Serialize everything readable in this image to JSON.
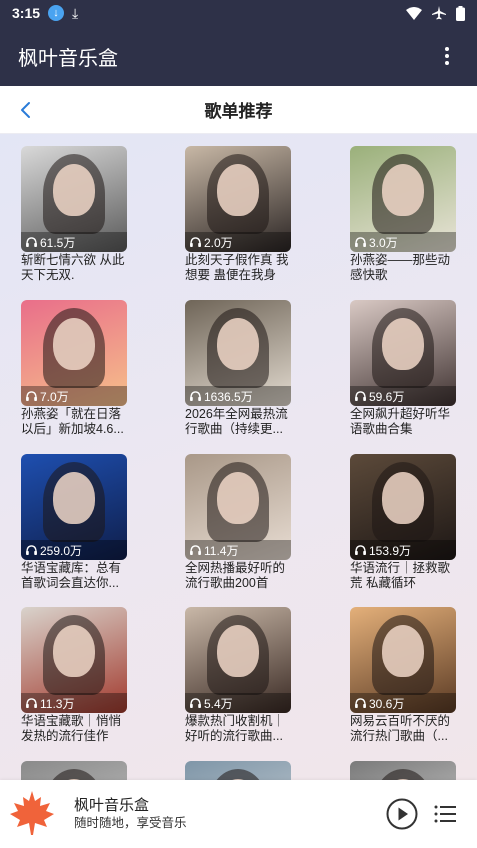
{
  "status_bar": {
    "time": "3:15",
    "icons": [
      "download-badge-icon",
      "download-icon",
      "wifi-icon",
      "airplane-icon",
      "battery-icon"
    ]
  },
  "app_bar": {
    "title": "枫叶音乐盒",
    "menu_icon": "more-vertical-icon"
  },
  "page_header": {
    "title": "歌单推荐",
    "back_icon": "chevron-left-icon"
  },
  "playlists": [
    {
      "count": "61.5万",
      "title": "斩断七情六欲 从此天下无双.",
      "colors": [
        "#d9d9d9",
        "#5a5a5a"
      ]
    },
    {
      "count": "2.0万",
      "title": "此刻天子假作真 我想要 蛊便在我身",
      "colors": [
        "#c8b8a6",
        "#2b2524"
      ]
    },
    {
      "count": "3.0万",
      "title": "孙燕姿——那些动感快歌",
      "colors": [
        "#9ab07a",
        "#e9e4d8"
      ]
    },
    {
      "count": "7.0万",
      "title": "孙燕姿「就在日落以后」新加坡4.6...",
      "colors": [
        "#e96e8a",
        "#f6c08a"
      ]
    },
    {
      "count": "1636.5万",
      "title": "2026年全网最热流行歌曲（持续更...",
      "colors": [
        "#6f6558",
        "#e3dbd0"
      ]
    },
    {
      "count": "59.6万",
      "title": "全网飙升超好听华语歌曲合集",
      "colors": [
        "#d9c9c4",
        "#403332"
      ]
    },
    {
      "count": "259.0万",
      "title": "华语宝藏库：总有首歌词会直达你...",
      "colors": [
        "#1e4fb0",
        "#0f1e4a"
      ]
    },
    {
      "count": "11.4万",
      "title": "全网热播最好听的流行歌曲200首",
      "colors": [
        "#a99888",
        "#e8ddd3"
      ]
    },
    {
      "count": "153.9万",
      "title": "华语流行｜拯救歌荒 私藏循环",
      "colors": [
        "#5c4a3a",
        "#1d1715"
      ]
    },
    {
      "count": "11.3万",
      "title": "华语宝藏歌｜悄悄发热的流行佳作",
      "colors": [
        "#d9d3cc",
        "#a23a2e"
      ]
    },
    {
      "count": "5.4万",
      "title": "爆款热门收割机｜好听的流行歌曲...",
      "colors": [
        "#c9b8a8",
        "#3a2a24"
      ]
    },
    {
      "count": "30.6万",
      "title": "网易云百听不厌的流行热门歌曲（...",
      "colors": [
        "#e4b07a",
        "#5a3a24"
      ]
    },
    {
      "count": "",
      "title": "",
      "colors": [
        "#8a8a8a",
        "#cfcfcf"
      ]
    },
    {
      "count": "",
      "title": "",
      "colors": [
        "#7f96a8",
        "#d5d9dc"
      ]
    },
    {
      "count": "",
      "title": "",
      "colors": [
        "#7a7a7a",
        "#e0e0e0"
      ]
    }
  ],
  "player": {
    "title": "枫叶音乐盒",
    "subtitle": "随时随地，享受音乐",
    "logo_icon": "maple-leaf-icon",
    "play_icon": "play-circle-icon",
    "playlist_icon": "playlist-icon",
    "accent": "#f0633a"
  }
}
